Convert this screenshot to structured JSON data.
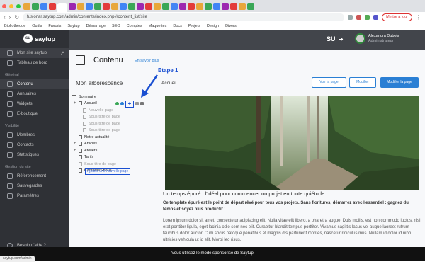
{
  "browser": {
    "tabs": [
      {
        "icon": "tab-favicon",
        "color": "#e8a73a"
      },
      {
        "icon": "tab-favicon",
        "color": "#3aa757"
      },
      {
        "icon": "tab-favicon",
        "color": "#4285f4"
      },
      {
        "icon": "tab-favicon",
        "color": "#e33b3b"
      },
      {
        "icon": "tab-favicon",
        "color": "#9c27b0"
      },
      {
        "icon": "tab-favicon",
        "color": "#e8a73a"
      }
    ],
    "address": "fusionar.saytup.com/admin/contents/index.php#/content_list/site",
    "profile_label": "Mettre à jour",
    "bookmarks": [
      "Bibliothèque",
      "Outils",
      "Favoris",
      "Saytup",
      "Démarrage",
      "SEO",
      "Comptes",
      "Maquettes",
      "Docs",
      "Projets",
      "Design",
      "Divers"
    ]
  },
  "sidebar": {
    "brand": "saytup",
    "site_link": "Mon site saytup",
    "dashboard": "Tableau de bord",
    "section_general": "Général",
    "items_general": [
      {
        "label": "Contenu",
        "icon": "file-icon",
        "active": true
      },
      {
        "label": "Annuaires",
        "icon": "list-icon",
        "active": false
      },
      {
        "label": "Widgets",
        "icon": "widget-icon",
        "active": false
      },
      {
        "label": "E-boutique",
        "icon": "cart-icon",
        "active": false
      }
    ],
    "section_visibility": "Visibilité",
    "items_visibility": [
      {
        "label": "Membres",
        "icon": "users-icon"
      },
      {
        "label": "Contacts",
        "icon": "contact-icon"
      },
      {
        "label": "Statistiques",
        "icon": "chart-icon"
      }
    ],
    "section_account": "Gestion du site",
    "items_account": [
      {
        "label": "Référencement",
        "icon": "search-icon"
      },
      {
        "label": "Sauvegardes",
        "icon": "save-icon"
      },
      {
        "label": "Paramètres",
        "icon": "gear-icon"
      }
    ],
    "footer": "Besoin d'aide ?"
  },
  "topbar": {
    "logo": "SU",
    "user_name": "Alexandra Dubois",
    "user_sub": "Administrateur"
  },
  "page": {
    "title": "Contenu",
    "help": "En savoir plus",
    "tree_title": "Mon arborescence",
    "tree_root": "Sommaire",
    "etape": "Etape 1",
    "tree": [
      {
        "label": "Accueil",
        "expander": "+",
        "muted": false,
        "tools": true
      },
      {
        "label": "Nouvelle page",
        "expander": "",
        "muted": true
      },
      {
        "label": "Sous-titre de page",
        "expander": "",
        "muted": true
      },
      {
        "label": "Sous-titre de page",
        "expander": "",
        "muted": true
      },
      {
        "label": "Sous-titre de page",
        "expander": "",
        "muted": true
      },
      {
        "label": "Notre actualité",
        "expander": "",
        "muted": false
      },
      {
        "label": "Articles",
        "expander": "+",
        "muted": false
      },
      {
        "label": "Ateliers",
        "expander": "+",
        "muted": false
      },
      {
        "label": "Tarifs",
        "expander": "",
        "muted": false
      },
      {
        "label": "Sous-titre de page",
        "expander": "",
        "muted": true
      },
      {
        "label": "Contactez-nous",
        "expander": "",
        "muted": false
      }
    ],
    "new_page": "Ajouter une nouvelle page",
    "content_title": "Accueil",
    "buttons": [
      "Voir la page",
      "Modifier",
      "Modifier la page"
    ],
    "caption": "Un temps épuré : l'idéal pour commencer un projet en toute quiétude.",
    "lead": "Ce template épuré est le point de départ rêvé pour tous vos projets. Sans fioritures, démarrez avec l'essentiel : gagnez du temps et soyez plus productif !",
    "body": "Lorem ipsum dolor sit amet, consectetur adipiscing elit. Nulla vitae elit libero, a pharetra augue. Duis mollis, est non commodo luctus, nisi erat porttitor ligula, eget lacinia odio sem nec elit. Curabitur blandit tempus porttitor. Vivamus sagittis lacus vel augue laoreet rutrum faucibus dolor auctor. Cum sociis natoque penatibus et magnis dis parturient montes, nascetur ridiculus mus. Nullam id dolor id nibh ultricies vehicula ut id elit. Morbi leo risus."
  },
  "banner": "Vous utilisez le mode sponsorisé de Saytup",
  "status": "saytup.com/admin",
  "colors": {
    "accent": "#2a7fd4",
    "annotation": "#1a4fd1",
    "sidebar": "#2f3136"
  }
}
